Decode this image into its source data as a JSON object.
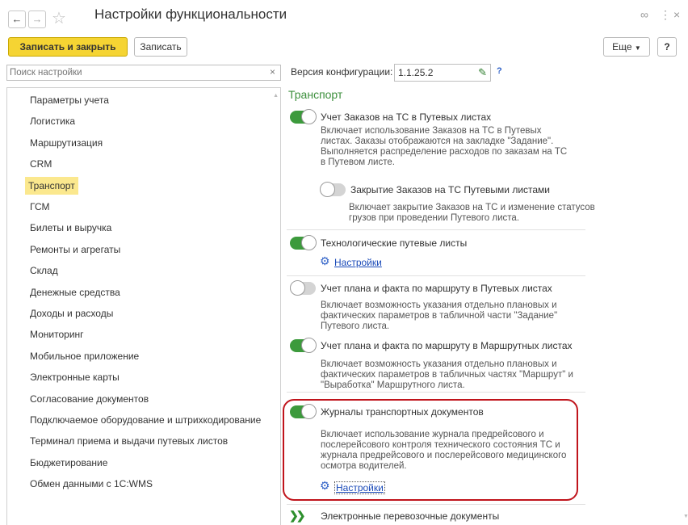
{
  "window": {
    "title": "Настройки функциональности",
    "back_icon": "arrow-left",
    "forward_icon": "arrow-right",
    "star_icon": "star-outline",
    "link_icon": "chain-link",
    "more_icon": "vertical-dots",
    "close_icon": "close"
  },
  "toolbar": {
    "save_close_label": "Записать и закрыть",
    "save_label": "Записать",
    "more_label": "Еще",
    "help_label": "?"
  },
  "search": {
    "placeholder": "Поиск настройки",
    "clear_label": "×"
  },
  "config": {
    "label": "Версия конфигурации:",
    "value": "1.1.25.2",
    "help_label": "?"
  },
  "sidebar": {
    "items": [
      {
        "label": "Параметры учета"
      },
      {
        "label": "Логистика"
      },
      {
        "label": "Маршрутизация"
      },
      {
        "label": "CRM"
      },
      {
        "label": "Транспорт"
      },
      {
        "label": "ГСМ"
      },
      {
        "label": "Билеты и выручка"
      },
      {
        "label": "Ремонты и агрегаты"
      },
      {
        "label": "Склад"
      },
      {
        "label": "Денежные средства"
      },
      {
        "label": "Доходы и расходы"
      },
      {
        "label": "Мониторинг"
      },
      {
        "label": "Мобильное приложение"
      },
      {
        "label": "Электронные карты"
      },
      {
        "label": "Согласование документов"
      },
      {
        "label": "Подключаемое оборудование и штрихкодирование"
      },
      {
        "label": "Терминал приема и выдачи путевых листов"
      },
      {
        "label": "Бюджетирование"
      },
      {
        "label": "Обмен данными с 1С:WMS"
      }
    ],
    "selected": "Транспорт"
  },
  "main": {
    "section_title": "Транспорт",
    "settings_link_label": "Настройки",
    "options": [
      {
        "label": "Учет Заказов на ТС в Путевых листах",
        "on": true,
        "desc": "Включает использование Заказов на ТС в Путевых\nлистах. Заказы отображаются на закладке \"Задание\".\nВыполняется распределение расходов по заказам на ТС\nв Путевом листе."
      },
      {
        "label": "Закрытие Заказов на ТС Путевыми листами",
        "on": false,
        "desc": "Включает закрытие Заказов на ТС и изменение статусов\nгрузов при проведении Путевого листа."
      },
      {
        "label": "Технологические путевые листы",
        "on": true,
        "desc": ""
      },
      {
        "label": "Учет плана и факта по маршруту в Путевых листах",
        "on": false,
        "desc": "Включает возможность указания отдельно плановых и\nфактических параметров в табличной части \"Задание\"\nПутевого листа."
      },
      {
        "label": "Учет плана и факта по маршруту в Маршрутных листах",
        "on": true,
        "desc": "Включает возможность указания отдельно плановых и\nфактических параметров в табличных частях \"Маршрут\" и\n\"Выработка\" Маршрутного листа."
      },
      {
        "label": "Журналы транспортных документов",
        "on": true,
        "desc": "Включает использование журнала предрейсового и\nпослерейсового контроля технического состояния ТС и\nжурнала предрейсового и послерейсового медицинского\nосмотра водителей."
      },
      {
        "label": "Электронные перевозочные документы",
        "on": null,
        "desc": ""
      }
    ]
  },
  "colors": {
    "accent_yellow": "#f5d433",
    "toggle_on": "#3c9a3c",
    "section_green": "#3c8f3c",
    "highlight_red": "#c0141c",
    "link_blue": "#1a4ab8"
  }
}
